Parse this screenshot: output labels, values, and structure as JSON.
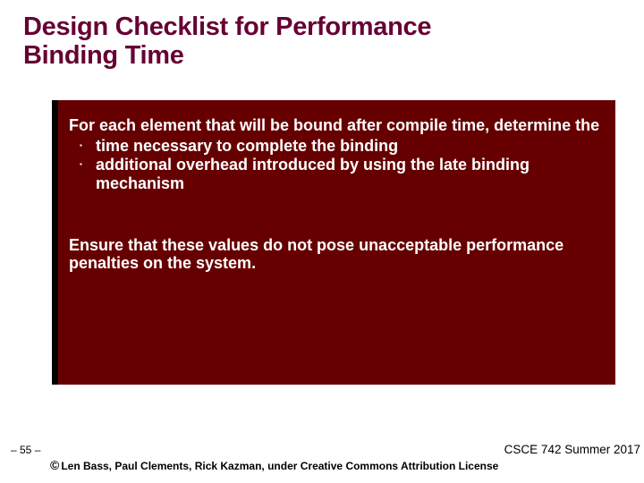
{
  "title_line1": "Design Checklist for Performance",
  "title_line2": "Binding Time",
  "body": {
    "intro": "For each element that will be bound after compile time, determine the",
    "bullets": [
      "time necessary to complete the binding",
      "additional overhead introduced by using the late binding mechanism"
    ],
    "closing": "Ensure that these values do not pose unacceptable performance penalties on the system."
  },
  "footer": {
    "page": "– 55 –",
    "course": "CSCE 742 Summer 2017",
    "attribution": "Len Bass, Paul Clements, Rick Kazman, under Creative Commons Attribution License",
    "copy_symbol": "©"
  }
}
